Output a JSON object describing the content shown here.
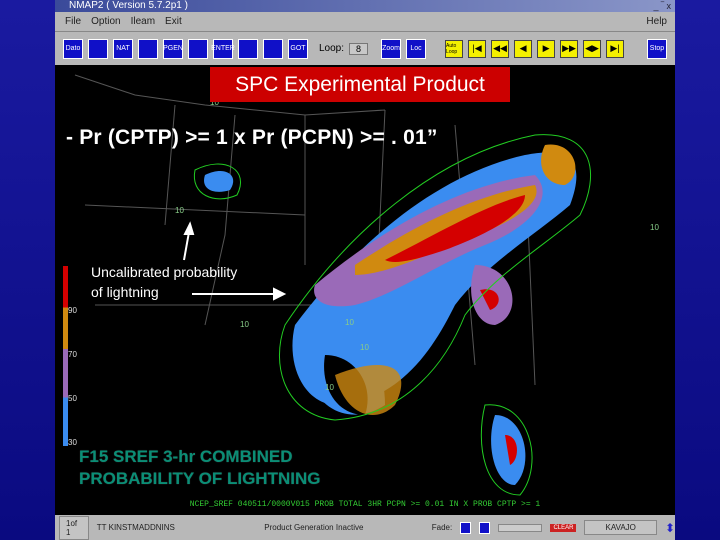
{
  "window": {
    "title": "NMAP2 ( Version 5.7.2p1 )",
    "controls": "_ ‾ x"
  },
  "menu": [
    "File",
    "Option",
    "Ileam",
    "Exit"
  ],
  "help": "Help",
  "toolbar": {
    "buttons": [
      "Dato",
      "",
      "NAT",
      "",
      "PGEN",
      "",
      "ENTER",
      "",
      "",
      "GOT"
    ],
    "loop_label": "Loop:",
    "loop_value": "8",
    "zoom": "Zoom",
    "other": "Loc",
    "animation": [
      "Auto Loop",
      "|◀",
      "◀◀",
      "◀",
      "▶",
      "▶▶",
      "◀▶",
      "▶|"
    ],
    "stop": "Stop"
  },
  "slide": {
    "banner": "SPC Experimental Product",
    "headline": "- Pr (CPTP) >= 1 x Pr (PCPN) >= . 01”",
    "note_line1": "Uncalibrated probability",
    "note_line2": "of lightning",
    "product_line1": "F15 SREF 3-hr COMBINED",
    "product_line2": "PROBABILITY OF LIGHTNING"
  },
  "map": {
    "info": "NCEP_SREF 040511/0000V015 PROB TOTAL 3HR PCPN >= 0.01 IN X PROB CPTP >= 1",
    "contours": [
      "10",
      "10",
      "10",
      "10",
      "10",
      "10",
      "10"
    ]
  },
  "legend": {
    "labels": [
      "90",
      "70",
      "50",
      "30"
    ],
    "colors": [
      "#d40000",
      "#d08a10",
      "#9a6ab8",
      "#3a8cf0"
    ]
  },
  "status": {
    "frame": "1of 1",
    "datetime": "TT KINSTMADDNINS",
    "message": "Product Generation Inactive",
    "fade": "Fade:",
    "clear": "CLEAR",
    "host": "KAVAJO"
  }
}
